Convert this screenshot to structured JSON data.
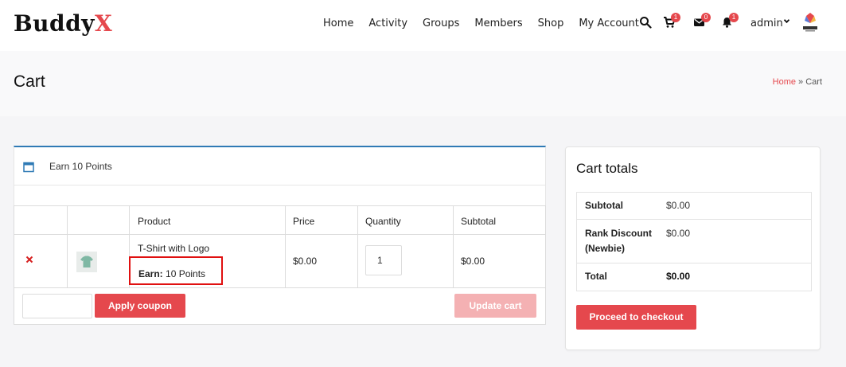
{
  "header": {
    "logo_part1": "Buddy",
    "logo_part2": "X",
    "nav": [
      "Home",
      "Activity",
      "Groups",
      "Members",
      "Shop",
      "My Account"
    ],
    "cart_count": "1",
    "messages_count": "0",
    "notifications_count": "1",
    "user_name": "admin",
    "accent_color": "#e5484d"
  },
  "page": {
    "title": "Cart",
    "breadcrumb_home": "Home",
    "breadcrumb_sep": " » ",
    "breadcrumb_current": "Cart"
  },
  "notice": {
    "text": "Earn 10 Points",
    "icon": "calendar-icon",
    "accent_color": "#2f7ab5"
  },
  "cart": {
    "columns": [
      "",
      "",
      "Product",
      "Price",
      "Quantity",
      "Subtotal"
    ],
    "items": [
      {
        "name": "T-Shirt with Logo",
        "earn_label": "Earn:",
        "earn_value": " 10 Points",
        "price": "$0.00",
        "quantity": "1",
        "subtotal": "$0.00"
      }
    ],
    "apply_coupon_label": "Apply coupon",
    "update_cart_label": "Update cart"
  },
  "totals": {
    "title": "Cart totals",
    "rows": [
      {
        "label": "Subtotal",
        "value": "$0.00"
      },
      {
        "label": "Rank Discount (Newbie)",
        "value": "$0.00"
      },
      {
        "label": "Total",
        "value": "$0.00"
      }
    ],
    "checkout_label": "Proceed to checkout"
  }
}
